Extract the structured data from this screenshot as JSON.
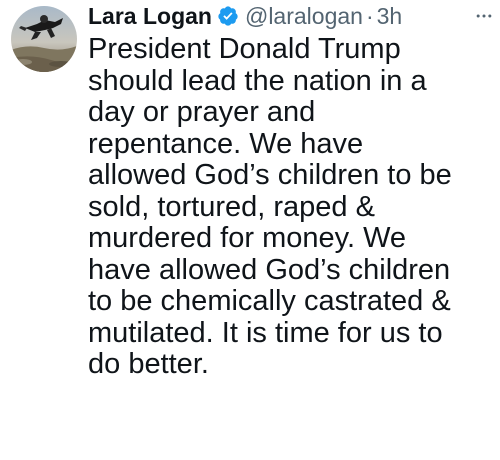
{
  "tweet": {
    "author": {
      "display_name": "Lara Logan",
      "handle": "@laralogan",
      "verified": true
    },
    "separator": "·",
    "time": "3h",
    "more_icon": "more-horizontal-icon",
    "verified_color": "#1d9bf0",
    "text_lines": [
      "President Donald Trump",
      "should lead the nation in a",
      "day or prayer and",
      "repentance. We have",
      "allowed God’s children to be",
      "sold, tortured, raped &",
      "murdered for money. We",
      "have allowed God’s children",
      "to be chemically castrated &",
      "mutilated. It is time for us to",
      "do better."
    ]
  }
}
